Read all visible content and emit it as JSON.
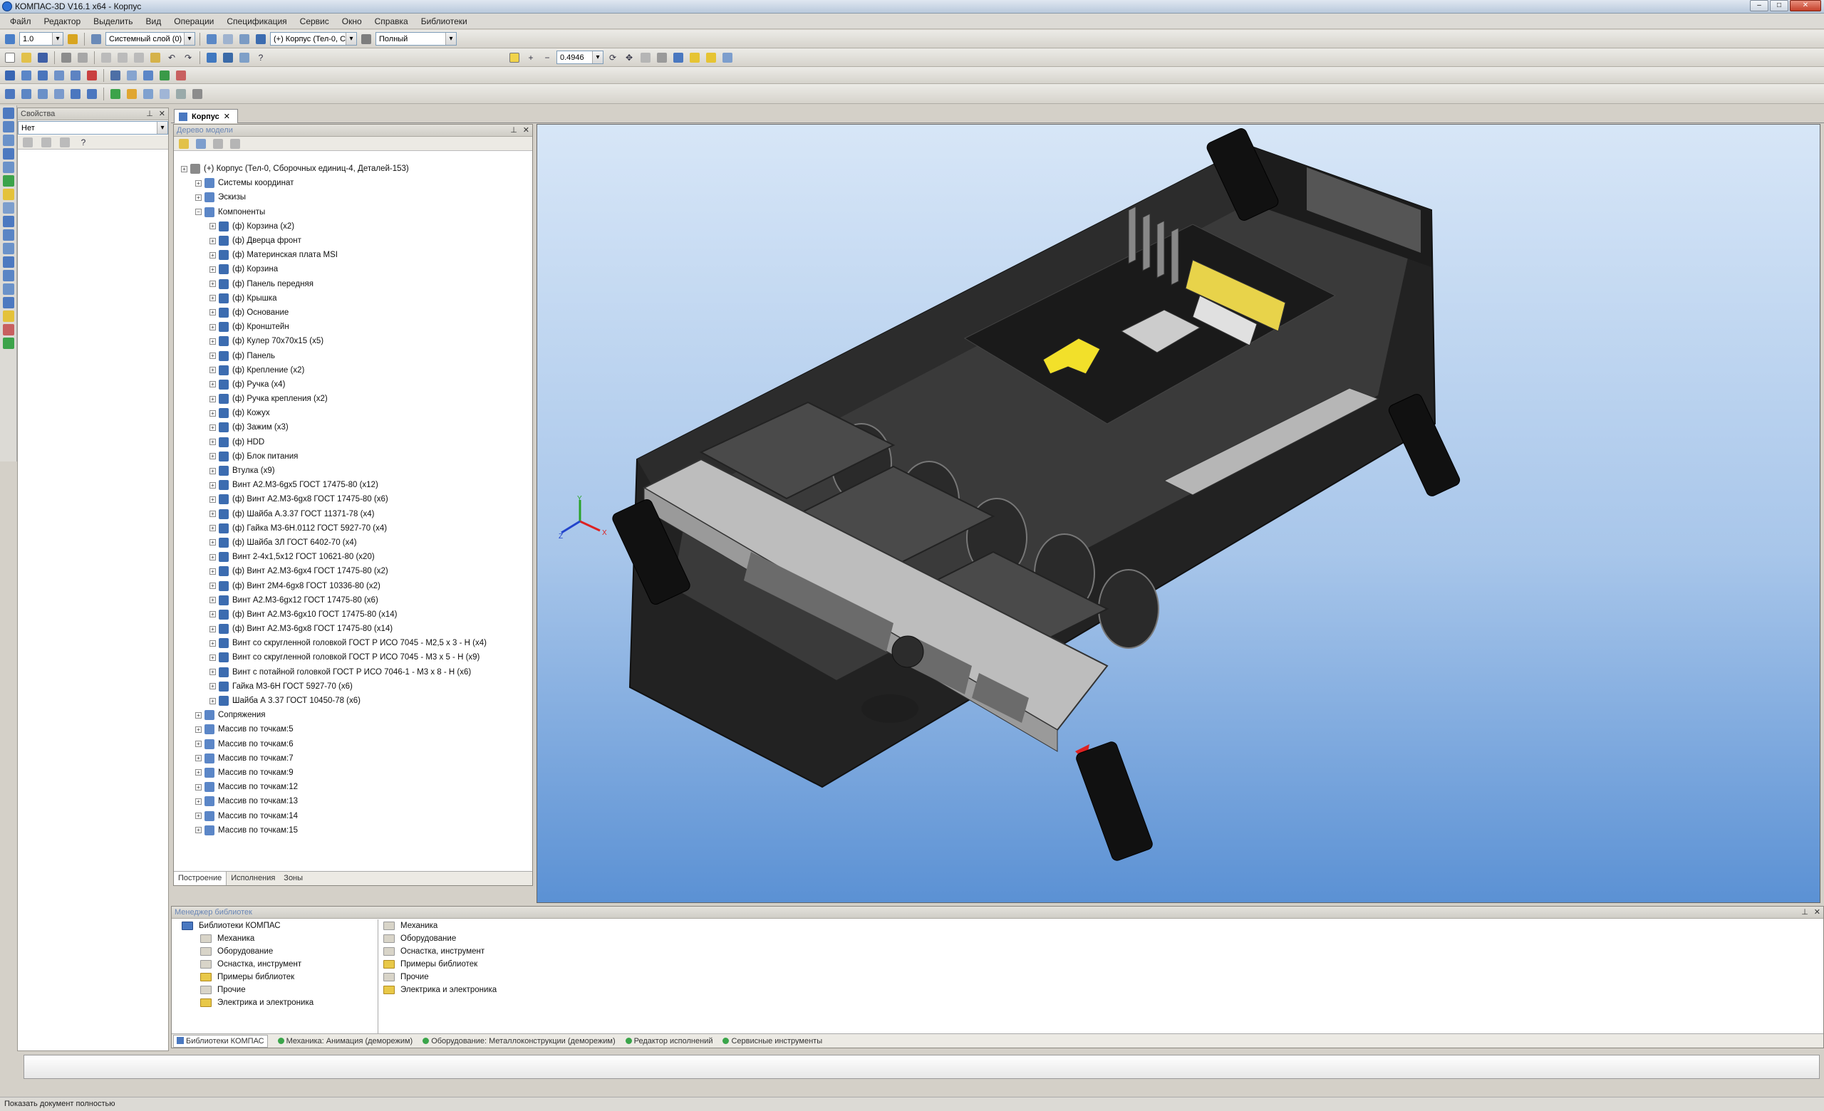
{
  "window": {
    "title": "КОМПАС-3D V16.1 x64 - Корпус"
  },
  "menu": [
    "Файл",
    "Редактор",
    "Выделить",
    "Вид",
    "Операции",
    "Спецификация",
    "Сервис",
    "Окно",
    "Справка",
    "Библиотеки"
  ],
  "toolbar": {
    "scale_value": "1.0",
    "layer_combo": "Системный слой (0)",
    "model_combo": "(+) Корпус (Тел-0, С",
    "mode_combo": "Полный",
    "zoom_value": "0.4946"
  },
  "properties": {
    "header": "Свойства",
    "combo": "Нет"
  },
  "doc_tab": "Корпус",
  "tree": {
    "header": "Дерево модели",
    "items": [
      {
        "label": "(+) Корпус (Тел-0, Сборочных единиц-4, Деталей-153)",
        "level": 0
      },
      {
        "label": "Системы координат",
        "level": 1
      },
      {
        "label": "Эскизы",
        "level": 1
      },
      {
        "label": "Компоненты",
        "level": 1
      },
      {
        "label": "(ф) Корзина (x2)",
        "level": 2
      },
      {
        "label": "(ф) Дверца фронт",
        "level": 2
      },
      {
        "label": "(ф) Материнская плата MSI",
        "level": 2
      },
      {
        "label": "(ф) Корзина",
        "level": 2
      },
      {
        "label": "(ф) Панель передняя",
        "level": 2
      },
      {
        "label": "(ф) Крышка",
        "level": 2
      },
      {
        "label": "(ф) Основание",
        "level": 2
      },
      {
        "label": "(ф) Кронштейн",
        "level": 2
      },
      {
        "label": "(ф) Кулер 70x70x15 (x5)",
        "level": 2
      },
      {
        "label": "(ф) Панель",
        "level": 2
      },
      {
        "label": "(ф) Крепление (x2)",
        "level": 2
      },
      {
        "label": "(ф) Ручка (x4)",
        "level": 2
      },
      {
        "label": "(ф) Ручка крепления (x2)",
        "level": 2
      },
      {
        "label": "(ф) Кожух",
        "level": 2
      },
      {
        "label": "(ф) Зажим (x3)",
        "level": 2
      },
      {
        "label": "(ф) HDD",
        "level": 2
      },
      {
        "label": "(ф) Блок питания",
        "level": 2
      },
      {
        "label": "Втулка (x9)",
        "level": 2
      },
      {
        "label": "Винт А2.М3-6gx5 ГОСТ 17475-80 (x12)",
        "level": 2
      },
      {
        "label": "(ф) Винт А2.М3-6gx8 ГОСТ 17475-80 (x6)",
        "level": 2
      },
      {
        "label": "(ф) Шайба А.3.37 ГОСТ 11371-78 (x4)",
        "level": 2
      },
      {
        "label": "(ф) Гайка М3-6Н.0112 ГОСТ 5927-70 (x4)",
        "level": 2
      },
      {
        "label": "(ф) Шайба 3Л ГОСТ 6402-70 (x4)",
        "level": 2
      },
      {
        "label": "Винт 2-4x1,5x12 ГОСТ 10621-80 (x20)",
        "level": 2
      },
      {
        "label": "(ф) Винт А2.М3-6gx4 ГОСТ 17475-80 (x2)",
        "level": 2
      },
      {
        "label": "(ф) Винт 2М4-6gx8 ГОСТ 10336-80 (x2)",
        "level": 2
      },
      {
        "label": "Винт А2.М3-6gx12 ГОСТ 17475-80 (x6)",
        "level": 2
      },
      {
        "label": "(ф) Винт А2.М3-6gx10 ГОСТ 17475-80 (x14)",
        "level": 2
      },
      {
        "label": "(ф) Винт А2.М3-6gx8 ГОСТ 17475-80 (x14)",
        "level": 2
      },
      {
        "label": "Винт со скругленной головкой ГОСТ Р ИСО 7045 - М2,5 x 3 - H (x4)",
        "level": 2
      },
      {
        "label": "Винт со скругленной головкой ГОСТ Р ИСО 7045 - М3 x 5 - H (x9)",
        "level": 2
      },
      {
        "label": "Винт с потайной головкой ГОСТ Р ИСО 7046-1 - М3 x 8 - H (x6)",
        "level": 2
      },
      {
        "label": "Гайка М3-6Н ГОСТ 5927-70 (x6)",
        "level": 2
      },
      {
        "label": "Шайба А 3.37 ГОСТ 10450-78 (x6)",
        "level": 2
      },
      {
        "label": "Сопряжения",
        "level": 1
      },
      {
        "label": "Массив по точкам:5",
        "level": 1
      },
      {
        "label": "Массив по точкам:6",
        "level": 1
      },
      {
        "label": "Массив по точкам:7",
        "level": 1
      },
      {
        "label": "Массив по точкам:9",
        "level": 1
      },
      {
        "label": "Массив по точкам:12",
        "level": 1
      },
      {
        "label": "Массив по точкам:13",
        "level": 1
      },
      {
        "label": "Массив по точкам:14",
        "level": 1
      },
      {
        "label": "Массив по точкам:15",
        "level": 1
      }
    ],
    "tabs": [
      "Построение",
      "Исполнения",
      "Зоны"
    ]
  },
  "axes": {
    "y": "Y",
    "x": "X",
    "z": "Z"
  },
  "library": {
    "header": "Менеджер библиотек",
    "root": "Библиотеки КОМПАС",
    "left_items": [
      "Механика",
      "Оборудование",
      "Оснастка, инструмент",
      "Примеры библиотек",
      "Прочие",
      "Электрика и электроника"
    ],
    "right_items": [
      "Механика",
      "Оборудование",
      "Оснастка, инструмент",
      "Примеры библиотек",
      "Прочие",
      "Электрика и электроника"
    ],
    "tabs": [
      "Библиотеки КОМПАС",
      "Механика: Анимация (деморежим)",
      "Оборудование: Металлоконструкции (деморежим)",
      "Редактор исполнений",
      "Сервисные инструменты"
    ]
  },
  "status": {
    "text": "Показать документ полностью"
  }
}
